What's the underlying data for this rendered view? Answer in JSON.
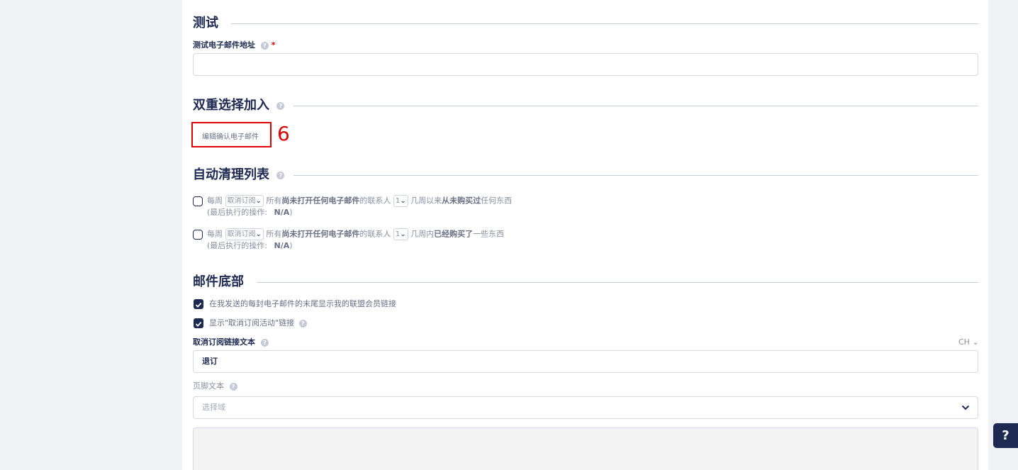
{
  "test": {
    "title": "测试",
    "email_label": "测试电子邮件地址",
    "required_mark": "*",
    "email_value": ""
  },
  "double_optin": {
    "title": "双重选择加入",
    "edit_button": "编辑确认电子邮件",
    "annotation": "6"
  },
  "auto_clean": {
    "title": "自动清理列表",
    "rules": [
      {
        "prefix": "每周",
        "action_select": "取消订阅",
        "all": "所有",
        "condition": "尚未打开任何电子邮件",
        "contacts": "的联系人",
        "weeks_select": "1",
        "since": "几周以来",
        "purchase": "从未购买过",
        "suffix": "任何东西",
        "last_action_label": "(最后执行的操作:",
        "last_action_value": "N/A",
        "close_paren": ")",
        "checked": false
      },
      {
        "prefix": "每周",
        "action_select": "取消订阅",
        "all": "所有",
        "condition": "尚未打开任何电子邮件",
        "contacts": "的联系人",
        "weeks_select": "1",
        "since": "几周内",
        "purchase": "已经购买了",
        "suffix": "一些东西",
        "last_action_label": "(最后执行的操作:",
        "last_action_value": "N/A",
        "close_paren": ")",
        "checked": false
      }
    ]
  },
  "footer": {
    "title": "邮件底部",
    "show_affiliate_label": "在我发送的每封电子邮件的末尾显示我的联盟会员链接",
    "show_affiliate_checked": true,
    "show_unsub_label": "显示\"取消订阅活动\"链接",
    "show_unsub_checked": true,
    "unsub_text_label": "取消订阅链接文本",
    "lang_selector": "CH",
    "unsub_text_value": "退订",
    "footer_text_label": "页脚文本",
    "domain_placeholder": "选择域"
  },
  "help_button": "?",
  "icons": {
    "help": "question-circle-icon",
    "chevron": "chevron-down-icon"
  },
  "colors": {
    "primary": "#1e2a52",
    "annotation_red": "#e00000",
    "background": "#f0f2f6"
  }
}
